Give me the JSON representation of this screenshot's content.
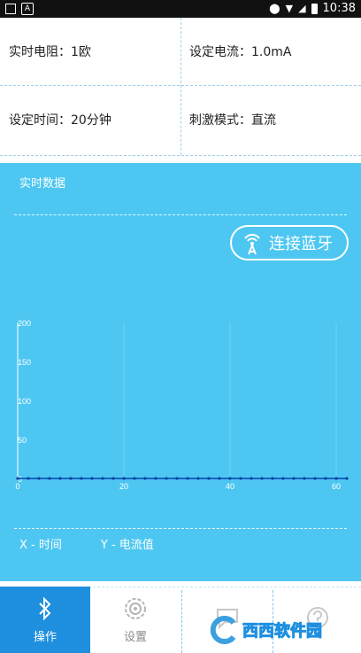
{
  "status": {
    "time": "10:38",
    "left_icon": "A"
  },
  "info": {
    "resistance": "实时电阻：1欧",
    "current_set": "设定电流：1.0mA",
    "time_set": "设定时间：20分钟",
    "mode": "刺激模式：直流"
  },
  "panel": {
    "title": "实时数据",
    "bt_label": "连接蓝牙",
    "legend_x": "X - 时间",
    "legend_y": "Y - 电流值"
  },
  "chart_data": {
    "type": "line",
    "x": [
      0,
      2,
      4,
      6,
      8,
      10,
      12,
      14,
      16,
      18,
      20,
      22,
      24,
      26,
      28,
      30,
      32,
      34,
      36,
      38,
      40,
      42,
      44,
      46,
      48,
      50,
      52,
      54,
      56,
      58,
      60,
      62
    ],
    "values": [
      0,
      0,
      0,
      0,
      0,
      0,
      0,
      0,
      0,
      0,
      0,
      0,
      0,
      0,
      0,
      0,
      0,
      0,
      0,
      0,
      0,
      0,
      0,
      0,
      0,
      0,
      0,
      0,
      0,
      0,
      0,
      0
    ],
    "xticks": [
      "0",
      "20",
      "40",
      "60"
    ],
    "yticks": [
      "0",
      "50",
      "100",
      "150",
      "200"
    ],
    "xlim": [
      0,
      62
    ],
    "ylim": [
      0,
      200
    ],
    "xlabel": "",
    "ylabel": "",
    "title": "",
    "line_color": "#1565c0"
  },
  "tabs": [
    {
      "label": "操作",
      "icon": "bluetooth-icon"
    },
    {
      "label": "设置",
      "icon": "gear-icon"
    },
    {
      "label": "",
      "icon": "chat-icon"
    },
    {
      "label": "",
      "icon": "help-icon"
    }
  ],
  "watermark": "西西软件园"
}
